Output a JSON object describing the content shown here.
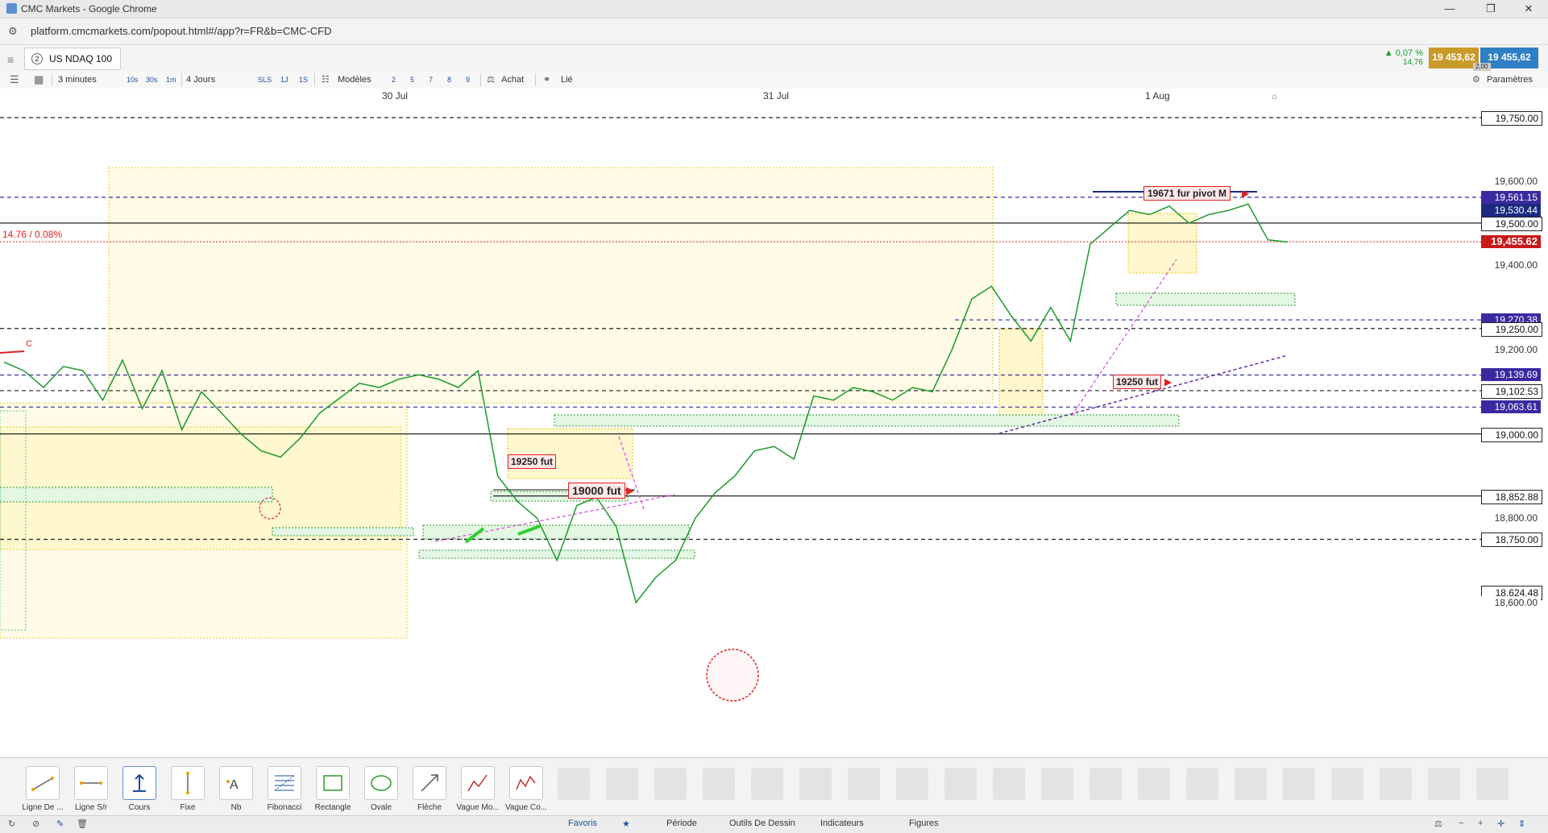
{
  "window": {
    "title": "CMC Markets - Google Chrome",
    "minimize": "—",
    "maximize": "❐",
    "close": "✕"
  },
  "browser": {
    "url": "platform.cmcmarkets.com/popout.html#/app?r=FR&b=CMC-CFD"
  },
  "instrument": {
    "tab_index": "2",
    "name": "US NDAQ 100",
    "change_pct": "▲ 0,07 %",
    "change_abs": "14,76",
    "sell_price": "19 453,62",
    "buy_price": "19 455,62",
    "spread": "2,00"
  },
  "toolbar": {
    "interval": "3 minutes",
    "intervals": [
      "10s",
      "30s",
      "1m"
    ],
    "period": "4 Jours",
    "quick_periods": [
      "SLS",
      "1J",
      "1S"
    ],
    "templates_label": "Modèles",
    "template_numbers": [
      "2",
      "5",
      "7",
      "8",
      "9"
    ],
    "buy_label": "Achat",
    "link_label": "Lié",
    "settings_label": "Paramètres"
  },
  "dates": [
    "30 Jul",
    "31 Jul",
    "1 Aug"
  ],
  "change_annotation": "14.76 / 0.08%",
  "annotations": {
    "pivot": "19671 fur pivot M",
    "fut_19250_left": "19250 fut",
    "fut_19250_right": "19250 fut",
    "fut_19000": "19000 fut",
    "marker_c": "C"
  },
  "price_axis": {
    "gridlines": [
      "19,750.00",
      "19,600.00",
      "19,500.00",
      "19,400.00",
      "19,250.00",
      "19,200.00",
      "19,102.53",
      "19,000.00",
      "18,852.88",
      "18,800.00",
      "18,750.00",
      "18,600.00"
    ],
    "levels": [
      {
        "label": "19,750.00",
        "price": 19750,
        "style": "plain"
      },
      {
        "label": "19,600.00",
        "price": 19600,
        "style": "plain"
      },
      {
        "label": "19,561.15",
        "price": 19561.15,
        "style": "purple"
      },
      {
        "label": "19,530.44",
        "price": 19530.44,
        "style": "navy"
      },
      {
        "label": "19,500.00",
        "price": 19500,
        "style": "plain"
      },
      {
        "label": "19,455.62",
        "price": 19455.62,
        "style": "red"
      },
      {
        "label": "19,400.00",
        "price": 19400,
        "style": "plain"
      },
      {
        "label": "19,270.38",
        "price": 19270.38,
        "style": "purple"
      },
      {
        "label": "19,250.00",
        "price": 19250,
        "style": "plain"
      },
      {
        "label": "19,200.00",
        "price": 19200,
        "style": "plain"
      },
      {
        "label": "19,139.69",
        "price": 19139.69,
        "style": "purple"
      },
      {
        "label": "19,102.53",
        "price": 19102.53,
        "style": "plain"
      },
      {
        "label": "19,063.61",
        "price": 19063.61,
        "style": "purple"
      },
      {
        "label": "19,000.00",
        "price": 19000,
        "style": "plain"
      },
      {
        "label": "18,852.88",
        "price": 18852.88,
        "style": "plain"
      },
      {
        "label": "18,800.00",
        "price": 18800,
        "style": "plain"
      },
      {
        "label": "18,750.00",
        "price": 18750,
        "style": "plain"
      },
      {
        "label": "18,624.48",
        "price": 18624.48,
        "style": "plain"
      },
      {
        "label": "18,600.00",
        "price": 18600,
        "style": "plain"
      }
    ]
  },
  "drawing_tools": [
    {
      "label": "Ligne De ...",
      "icon": "trend-line-icon"
    },
    {
      "label": "Ligne S/r",
      "icon": "sr-line-icon"
    },
    {
      "label": "Cours",
      "icon": "price-marker-icon"
    },
    {
      "label": "Fixe",
      "icon": "fixed-line-icon"
    },
    {
      "label": "Nb",
      "icon": "text-note-icon"
    },
    {
      "label": "Fibonacci",
      "icon": "fibonacci-icon"
    },
    {
      "label": "Rectangle",
      "icon": "rectangle-icon"
    },
    {
      "label": "Ovale",
      "icon": "oval-icon"
    },
    {
      "label": "Flèche",
      "icon": "arrow-icon"
    },
    {
      "label": "Vague Mo...",
      "icon": "motive-wave-icon"
    },
    {
      "label": "Vague Co...",
      "icon": "corrective-wave-icon"
    }
  ],
  "bottom_tabs": [
    "Favoris",
    "Période",
    "Outils De Dessin",
    "Indicateurs",
    "Figures"
  ],
  "colors": {
    "up": "#1a9a2a",
    "down": "#d8a020",
    "accent": "#1a4f9c",
    "sell": "#c89a2a",
    "buy": "#2f7fc4"
  },
  "chart_data": {
    "type": "line",
    "xlabel": "",
    "ylabel": "",
    "x": [
      "30 Jul",
      "31 Jul",
      "1 Aug"
    ],
    "ylim": [
      18580,
      19800
    ],
    "grid": false,
    "series": [
      {
        "values": [
          19170,
          19150,
          19110,
          19160,
          19150,
          19080,
          19175,
          19060,
          19150,
          19010,
          19100,
          19050,
          19000,
          18960,
          18945,
          18990,
          19050,
          19085,
          19120,
          19110,
          19130,
          19140,
          19130,
          19110,
          19150,
          18900,
          18840,
          18800,
          18700,
          18830,
          18850,
          18780,
          18600,
          18660,
          18700,
          18800,
          18860,
          18900,
          18960,
          18970,
          18940,
          19090,
          19080,
          19110,
          19100,
          19080,
          19110,
          19100,
          19200,
          19320,
          19350,
          19280,
          19220,
          19300,
          19220,
          19450,
          19490,
          19530,
          19520,
          19540,
          19500,
          19520,
          19530,
          19545,
          19460,
          19455
        ]
      }
    ]
  }
}
